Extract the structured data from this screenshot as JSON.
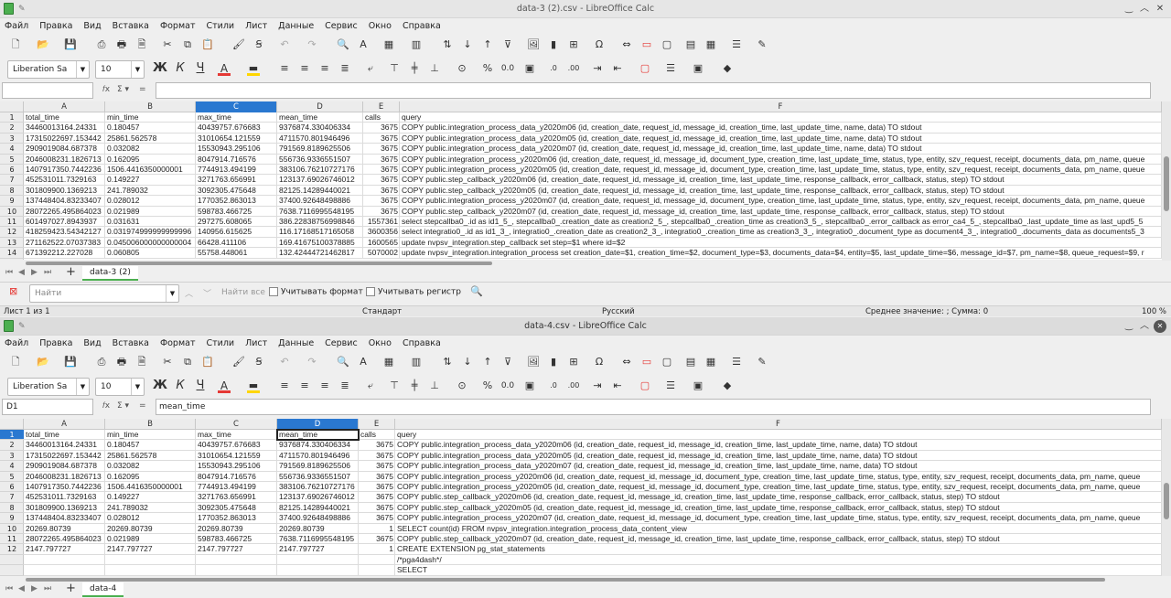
{
  "windows": [
    {
      "title": "data-3 (2).csv - LibreOffice Calc",
      "namebox": "",
      "formula": "",
      "selected_col": "C",
      "selected_row": null,
      "sheet_tab": "data-3 (2)",
      "statusbar": {
        "sheet": "Лист 1 из 1",
        "style": "Стандарт",
        "lang": "Русский",
        "summary": "Среднее значение: ; Сумма: 0",
        "zoom": "100 %"
      },
      "find": {
        "placeholder": "Найти",
        "find_all": "Найти все",
        "match_format": "Учитывать формат",
        "match_case": "Учитывать регистр"
      }
    },
    {
      "title": "data-4.csv - LibreOffice Calc",
      "namebox": "D1",
      "formula": "mean_time",
      "selected_col": "D",
      "selected_row": "1",
      "sheet_tab": "data-4"
    }
  ],
  "menu": [
    "Файл",
    "Правка",
    "Вид",
    "Вставка",
    "Формат",
    "Стили",
    "Лист",
    "Данные",
    "Сервис",
    "Окно",
    "Справка"
  ],
  "font": {
    "name": "Liberation Sa",
    "size": "10"
  },
  "columns": [
    "A",
    "B",
    "C",
    "D",
    "E",
    "F"
  ],
  "sheet1_rows": [
    [
      "1",
      "total_time",
      "min_time",
      "max_time",
      "mean_time",
      "calls",
      "query"
    ],
    [
      "2",
      "34460013164.24331",
      "0.180457",
      "40439757.676683",
      "9376874.330406334",
      "3675",
      "COPY public.integration_process_data_y2020m06 (id, creation_date, request_id, message_id, creation_time, last_update_time, name, data) TO stdout"
    ],
    [
      "3",
      "17315022697.153442",
      "25861.562578",
      "31010654.121559",
      "4711570.801946496",
      "3675",
      "COPY public.integration_process_data_y2020m05 (id, creation_date, request_id, message_id, creation_time, last_update_time, name, data) TO stdout"
    ],
    [
      "4",
      "2909019084.687378",
      "0.032082",
      "15530943.295106",
      "791569.8189625506",
      "3675",
      "COPY public.integration_process_data_y2020m07 (id, creation_date, request_id, message_id, creation_time, last_update_time, name, data) TO stdout"
    ],
    [
      "5",
      "2046008231.1826713",
      "0.162095",
      "8047914.716576",
      "556736.9336551507",
      "3675",
      "COPY public.integration_process_y2020m06 (id, creation_date, request_id, message_id, document_type, creation_time, last_update_time, status, type, entity, szv_request, receipt, documents_data, pm_name, queue"
    ],
    [
      "6",
      "1407917350.7442236",
      "1506.4416350000001",
      "7744913.494199",
      "383106.76210727176",
      "3675",
      "COPY public.integration_process_y2020m05 (id, creation_date, request_id, message_id, document_type, creation_time, last_update_time, status, type, entity, szv_request, receipt, documents_data, pm_name, queue"
    ],
    [
      "7",
      "452531011.7329163",
      "0.149227",
      "3271763.656991",
      "123137.69026746012",
      "3675",
      "COPY public.step_callback_y2020m06 (id, creation_date, request_id, message_id, creation_time, last_update_time, response_callback, error_callback, status, step) TO stdout"
    ],
    [
      "8",
      "301809900.1369213",
      "241.789032",
      "3092305.475648",
      "82125.14289440021",
      "3675",
      "COPY public.step_callback_y2020m05 (id, creation_date, request_id, message_id, creation_time, last_update_time, response_callback, error_callback, status, step) TO stdout"
    ],
    [
      "9",
      "137448404.83233407",
      "0.028012",
      "1770352.863013",
      "37400.92648498886",
      "3675",
      "COPY public.integration_process_y2020m07 (id, creation_date, request_id, message_id, document_type, creation_time, last_update_time, status, type, entity, szv_request, receipt, documents_data, pm_name, queue"
    ],
    [
      "10",
      "28072265.495864023",
      "0.021989",
      "598783.466725",
      "7638.7116995548195",
      "3675",
      "COPY public.step_callback_y2020m07 (id, creation_date, request_id, message_id, creation_time, last_update_time, response_callback, error_callback, status, step) TO stdout"
    ],
    [
      "11",
      "601497027.8943937",
      "0.031631",
      "297275.608065",
      "386.22838756998846",
      "1557361",
      "select stepcallba0_.id as id1_5_, stepcallba0_.creation_date as creation2_5_, stepcallba0_.creation_time as creation3_5_, stepcallba0_.error_callback as error_ca4_5_, stepcallba0_.last_update_time as last_upd5_5"
    ],
    [
      "12",
      "418259423.54342127",
      "0.031974999999999996",
      "140956.615625",
      "116.17168517165058",
      "3600356",
      "select integratio0_.id as id1_3_, integratio0_.creation_date as creation2_3_, integratio0_.creation_time as creation3_3_, integratio0_.document_type as document4_3_, integratio0_.documents_data as documents5_3"
    ],
    [
      "13",
      "271162522.07037383",
      "0.045006000000000004",
      "66428.411106",
      "169.41675100378885",
      "1600565",
      "update nvpsv_integration.step_callback set step=$1 where id=$2"
    ],
    [
      "14",
      "671392212.227028",
      "0.060805",
      "55758.448061",
      "132.42444721462817",
      "5070002",
      "update nvpsv_integration.integration_process set creation_date=$1, creation_time=$2, document_type=$3, documents_data=$4, entity=$5, last_update_time=$6, message_id=$7, pm_name=$8, queue_request=$9, r"
    ]
  ],
  "sheet2_rows": [
    [
      "1",
      "total_time",
      "min_time",
      "max_time",
      "mean_time",
      "calls",
      "query"
    ],
    [
      "2",
      "34460013164.24331",
      "0.180457",
      "40439757.676683",
      "9376874.330406334",
      "3675",
      "COPY public.integration_process_data_y2020m06 (id, creation_date, request_id, message_id, creation_time, last_update_time, name, data) TO stdout"
    ],
    [
      "3",
      "17315022697.153442",
      "25861.562578",
      "31010654.121559",
      "4711570.801946496",
      "3675",
      "COPY public.integration_process_data_y2020m05 (id, creation_date, request_id, message_id, creation_time, last_update_time, name, data) TO stdout"
    ],
    [
      "4",
      "2909019084.687378",
      "0.032082",
      "15530943.295106",
      "791569.8189625506",
      "3675",
      "COPY public.integration_process_data_y2020m07 (id, creation_date, request_id, message_id, creation_time, last_update_time, name, data) TO stdout"
    ],
    [
      "5",
      "2046008231.1826713",
      "0.162095",
      "8047914.716576",
      "556736.9336551507",
      "3675",
      "COPY public.integration_process_y2020m06 (id, creation_date, request_id, message_id, document_type, creation_time, last_update_time, status, type, entity, szv_request, receipt, documents_data, pm_name, queue"
    ],
    [
      "6",
      "1407917350.7442236",
      "1506.4416350000001",
      "7744913.494199",
      "383106.76210727176",
      "3675",
      "COPY public.integration_process_y2020m05 (id, creation_date, request_id, message_id, document_type, creation_time, last_update_time, status, type, entity, szv_request, receipt, documents_data, pm_name, queue"
    ],
    [
      "7",
      "452531011.7329163",
      "0.149227",
      "3271763.656991",
      "123137.69026746012",
      "3675",
      "COPY public.step_callback_y2020m06 (id, creation_date, request_id, message_id, creation_time, last_update_time, response_callback, error_callback, status, step) TO stdout"
    ],
    [
      "8",
      "301809900.1369213",
      "241.789032",
      "3092305.475648",
      "82125.14289440021",
      "3675",
      "COPY public.step_callback_y2020m05 (id, creation_date, request_id, message_id, creation_time, last_update_time, response_callback, error_callback, status, step) TO stdout"
    ],
    [
      "9",
      "137448404.83233407",
      "0.028012",
      "1770352.863013",
      "37400.92648498886",
      "3675",
      "COPY public.integration_process_y2020m07 (id, creation_date, request_id, message_id, document_type, creation_time, last_update_time, status, type, entity, szv_request, receipt, documents_data, pm_name, queue"
    ],
    [
      "10",
      "20269.80739",
      "20269.80739",
      "20269.80739",
      "20269.80739",
      "1",
      "SELECT count(id) FROM nvpsv_integration.integration_process_data_content_view"
    ],
    [
      "11",
      "28072265.495864023",
      "0.021989",
      "598783.466725",
      "7638.7116995548195",
      "3675",
      "COPY public.step_callback_y2020m07 (id, creation_date, request_id, message_id, creation_time, last_update_time, response_callback, error_callback, status, step) TO stdout"
    ],
    [
      "12",
      "2147.797727",
      "2147.797727",
      "2147.797727",
      "2147.797727",
      "1",
      "CREATE EXTENSION pg_stat_statements"
    ],
    [
      "",
      "",
      "",
      "",
      "",
      "",
      "/*pga4dash*/"
    ],
    [
      "",
      "",
      "",
      "",
      "",
      "",
      "SELECT"
    ]
  ],
  "colors": {
    "accent": "#2a78d0",
    "app_green": "#4caf50",
    "font_red": "#e53935",
    "highlight_yellow": "#ffd600"
  }
}
